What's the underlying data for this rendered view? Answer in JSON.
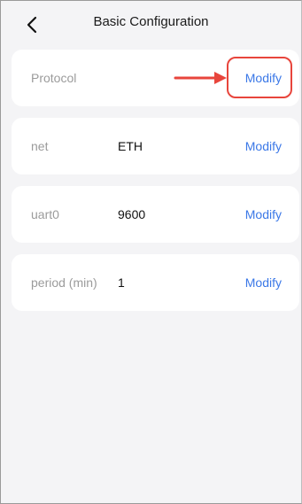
{
  "header": {
    "back_icon": "chevron-left-icon",
    "title": "Basic Configuration"
  },
  "rows": [
    {
      "label": "Protocol",
      "value": "",
      "action": "Modify"
    },
    {
      "label": "net",
      "value": "ETH",
      "action": "Modify"
    },
    {
      "label": "uart0",
      "value": "9600",
      "action": "Modify"
    },
    {
      "label": "period (min)",
      "value": "1",
      "action": "Modify"
    }
  ],
  "annotation": {
    "color": "#e8453c",
    "target": "Protocol Modify button"
  },
  "colors": {
    "accent": "#3b78e7",
    "background": "#f4f4f6",
    "card": "#ffffff"
  }
}
